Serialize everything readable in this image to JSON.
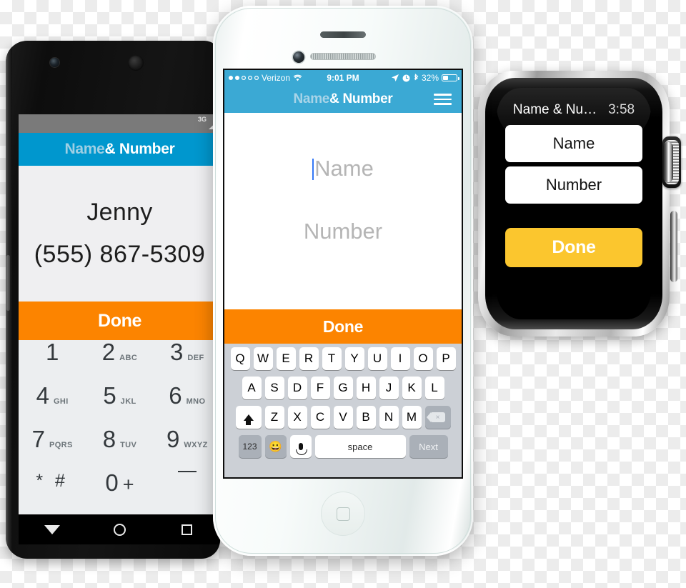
{
  "scene": {
    "description": "Three device mockups of a Name & Number app",
    "colors": {
      "android_header_blue": "#0097CE",
      "ios_header_blue": "#3BA9D4",
      "done_orange": "#FC8400",
      "watch_done_amber": "#FBC62E",
      "ios_caret_blue": "#3478F6"
    }
  },
  "android": {
    "status": {
      "network": "3G"
    },
    "header": {
      "title_dim": "Name",
      "title_bright": "& Number"
    },
    "content": {
      "name": "Jenny",
      "number": "(555) 867-5309"
    },
    "done_label": "Done",
    "dialpad": [
      {
        "num": "1",
        "sub": ""
      },
      {
        "num": "2",
        "sub": "ABC"
      },
      {
        "num": "3",
        "sub": "DEF"
      },
      {
        "num": "4",
        "sub": "GHI"
      },
      {
        "num": "5",
        "sub": "JKL"
      },
      {
        "num": "6",
        "sub": "MNO"
      },
      {
        "num": "7",
        "sub": "PQRS"
      },
      {
        "num": "8",
        "sub": "TUV"
      },
      {
        "num": "9",
        "sub": "WXYZ"
      },
      {
        "num": "* #",
        "sub": ""
      },
      {
        "num": "0",
        "sub": "+"
      },
      {
        "num": "_",
        "sub": ""
      }
    ],
    "nav": {
      "back": "back-icon",
      "home": "home-icon",
      "recents": "recents-icon"
    }
  },
  "iphone": {
    "status": {
      "signal_dots": "●●○○○",
      "carrier": "Verizon",
      "wifi": "wifi-icon",
      "time": "9:01 PM",
      "location": "location-arrow-icon",
      "alarm": "alarm-icon",
      "bluetooth": "bluetooth-icon",
      "battery_percent": "32%"
    },
    "header": {
      "title_dim": "Name",
      "title_bright": "& Number",
      "menu": "hamburger-menu-icon"
    },
    "form": {
      "name_placeholder": "Name",
      "number_placeholder": "Number"
    },
    "done_label": "Done",
    "keyboard": {
      "row1": [
        "Q",
        "W",
        "E",
        "R",
        "T",
        "Y",
        "U",
        "I",
        "O",
        "P"
      ],
      "row2": [
        "A",
        "S",
        "D",
        "F",
        "G",
        "H",
        "J",
        "K",
        "L"
      ],
      "row3": [
        "Z",
        "X",
        "C",
        "V",
        "B",
        "N",
        "M"
      ],
      "shift": "shift-icon",
      "delete": "delete-icon",
      "numbers_label": "123",
      "emoji": "😀",
      "dictation": "microphone-icon",
      "space_label": "space",
      "return_label": "Next"
    }
  },
  "watch": {
    "title": "Name & Nu…",
    "time": "3:58",
    "fields": [
      "Name",
      "Number"
    ],
    "done_label": "Done",
    "crown": "digital-crown",
    "side_button": "side-button"
  }
}
